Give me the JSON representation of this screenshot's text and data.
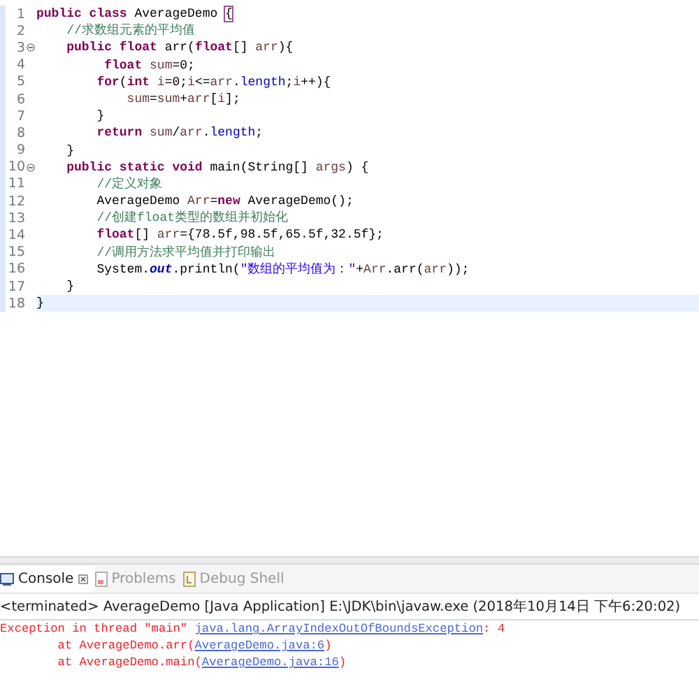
{
  "editor": {
    "lines": [
      {
        "number": "1",
        "fold": false,
        "current": false,
        "tokens": [
          {
            "kind": "keyword",
            "text": "public class"
          },
          {
            "kind": "plain",
            "text": " AverageDemo "
          },
          {
            "kind": "match",
            "text": "{"
          }
        ]
      },
      {
        "number": "2",
        "fold": false,
        "current": false,
        "tokens": [
          {
            "kind": "comment",
            "text": "    //求数组元素的平均值"
          }
        ]
      },
      {
        "number": "3",
        "fold": true,
        "current": false,
        "tokens": [
          {
            "kind": "keyword",
            "text": "    public float"
          },
          {
            "kind": "plain",
            "text": " arr("
          },
          {
            "kind": "keyword",
            "text": "float"
          },
          {
            "kind": "plain",
            "text": "[] "
          },
          {
            "kind": "local",
            "text": "arr"
          },
          {
            "kind": "plain",
            "text": "){"
          }
        ]
      },
      {
        "number": "4",
        "fold": false,
        "current": false,
        "tokens": [
          {
            "kind": "keyword",
            "text": "         float"
          },
          {
            "kind": "local",
            "text": " sum"
          },
          {
            "kind": "plain",
            "text": "=0;"
          }
        ]
      },
      {
        "number": "5",
        "fold": false,
        "current": false,
        "tokens": [
          {
            "kind": "keyword",
            "text": "        for"
          },
          {
            "kind": "plain",
            "text": "("
          },
          {
            "kind": "keyword",
            "text": "int"
          },
          {
            "kind": "local",
            "text": " i"
          },
          {
            "kind": "plain",
            "text": "=0;"
          },
          {
            "kind": "local",
            "text": "i"
          },
          {
            "kind": "plain",
            "text": "<="
          },
          {
            "kind": "local",
            "text": "arr"
          },
          {
            "kind": "plain",
            "text": "."
          },
          {
            "kind": "field",
            "text": "length"
          },
          {
            "kind": "plain",
            "text": ";"
          },
          {
            "kind": "local",
            "text": "i"
          },
          {
            "kind": "plain",
            "text": "++){"
          }
        ]
      },
      {
        "number": "6",
        "fold": false,
        "current": false,
        "tokens": [
          {
            "kind": "local",
            "text": "            sum"
          },
          {
            "kind": "plain",
            "text": "="
          },
          {
            "kind": "local",
            "text": "sum"
          },
          {
            "kind": "plain",
            "text": "+"
          },
          {
            "kind": "local",
            "text": "arr"
          },
          {
            "kind": "plain",
            "text": "["
          },
          {
            "kind": "local",
            "text": "i"
          },
          {
            "kind": "plain",
            "text": "];"
          }
        ]
      },
      {
        "number": "7",
        "fold": false,
        "current": false,
        "tokens": [
          {
            "kind": "plain",
            "text": "        }"
          }
        ]
      },
      {
        "number": "8",
        "fold": false,
        "current": false,
        "tokens": [
          {
            "kind": "keyword",
            "text": "        return"
          },
          {
            "kind": "local",
            "text": " sum"
          },
          {
            "kind": "plain",
            "text": "/"
          },
          {
            "kind": "local",
            "text": "arr"
          },
          {
            "kind": "plain",
            "text": "."
          },
          {
            "kind": "field",
            "text": "length"
          },
          {
            "kind": "plain",
            "text": ";"
          }
        ]
      },
      {
        "number": "9",
        "fold": false,
        "current": false,
        "tokens": [
          {
            "kind": "plain",
            "text": "    }"
          }
        ]
      },
      {
        "number": "10",
        "fold": true,
        "current": false,
        "tokens": [
          {
            "kind": "keyword",
            "text": "    public static void"
          },
          {
            "kind": "plain",
            "text": " main(String[] "
          },
          {
            "kind": "local",
            "text": "args"
          },
          {
            "kind": "plain",
            "text": ") {"
          }
        ]
      },
      {
        "number": "11",
        "fold": false,
        "current": false,
        "tokens": [
          {
            "kind": "comment",
            "text": "        //定义对象"
          }
        ]
      },
      {
        "number": "12",
        "fold": false,
        "current": false,
        "tokens": [
          {
            "kind": "plain",
            "text": "        AverageDemo "
          },
          {
            "kind": "local",
            "text": "Arr"
          },
          {
            "kind": "plain",
            "text": "="
          },
          {
            "kind": "keyword",
            "text": "new"
          },
          {
            "kind": "plain",
            "text": " AverageDemo();"
          }
        ]
      },
      {
        "number": "13",
        "fold": false,
        "current": false,
        "tokens": [
          {
            "kind": "comment",
            "text": "        //创建float类型的数组并初始化"
          }
        ]
      },
      {
        "number": "14",
        "fold": false,
        "current": false,
        "tokens": [
          {
            "kind": "keyword",
            "text": "        float"
          },
          {
            "kind": "plain",
            "text": "[] "
          },
          {
            "kind": "local",
            "text": "arr"
          },
          {
            "kind": "plain",
            "text": "={78.5f,98.5f,65.5f,32.5f};"
          }
        ]
      },
      {
        "number": "15",
        "fold": false,
        "current": false,
        "tokens": [
          {
            "kind": "comment",
            "text": "        //调用方法求平均值并打印输出"
          }
        ]
      },
      {
        "number": "16",
        "fold": false,
        "current": false,
        "tokens": [
          {
            "kind": "plain",
            "text": "        System."
          },
          {
            "kind": "static",
            "text": "out"
          },
          {
            "kind": "plain",
            "text": ".println("
          },
          {
            "kind": "string",
            "text": "\"数组的平均值为：\""
          },
          {
            "kind": "plain",
            "text": "+"
          },
          {
            "kind": "local",
            "text": "Arr"
          },
          {
            "kind": "plain",
            "text": ".arr("
          },
          {
            "kind": "local",
            "text": "arr"
          },
          {
            "kind": "plain",
            "text": "));"
          }
        ]
      },
      {
        "number": "17",
        "fold": false,
        "current": false,
        "tokens": [
          {
            "kind": "plain",
            "text": "    }"
          }
        ]
      },
      {
        "number": "18",
        "fold": false,
        "current": true,
        "tokens": [
          {
            "kind": "plain",
            "text": "}"
          }
        ]
      }
    ]
  },
  "console": {
    "tabs": [
      {
        "label": "Console",
        "selected": true,
        "closable": true
      },
      {
        "label": "Problems",
        "selected": false,
        "closable": false
      },
      {
        "label": "Debug Shell",
        "selected": false,
        "closable": false
      }
    ],
    "header": "<terminated> AverageDemo [Java Application] E:\\JDK\\bin\\javaw.exe (2018年10月14日 下午6:20:02)",
    "output": [
      [
        {
          "kind": "error",
          "text": "Exception in thread \"main\" "
        },
        {
          "kind": "link",
          "text": "java.lang.ArrayIndexOutOfBoundsException"
        },
        {
          "kind": "error",
          "text": ": 4"
        }
      ],
      [
        {
          "kind": "error",
          "text": "        at AverageDemo.arr("
        },
        {
          "kind": "link",
          "text": "AverageDemo.java:6"
        },
        {
          "kind": "error",
          "text": ")"
        }
      ],
      [
        {
          "kind": "error",
          "text": "        at AverageDemo.main("
        },
        {
          "kind": "link",
          "text": "AverageDemo.java:16"
        },
        {
          "kind": "error",
          "text": ")"
        }
      ]
    ]
  }
}
